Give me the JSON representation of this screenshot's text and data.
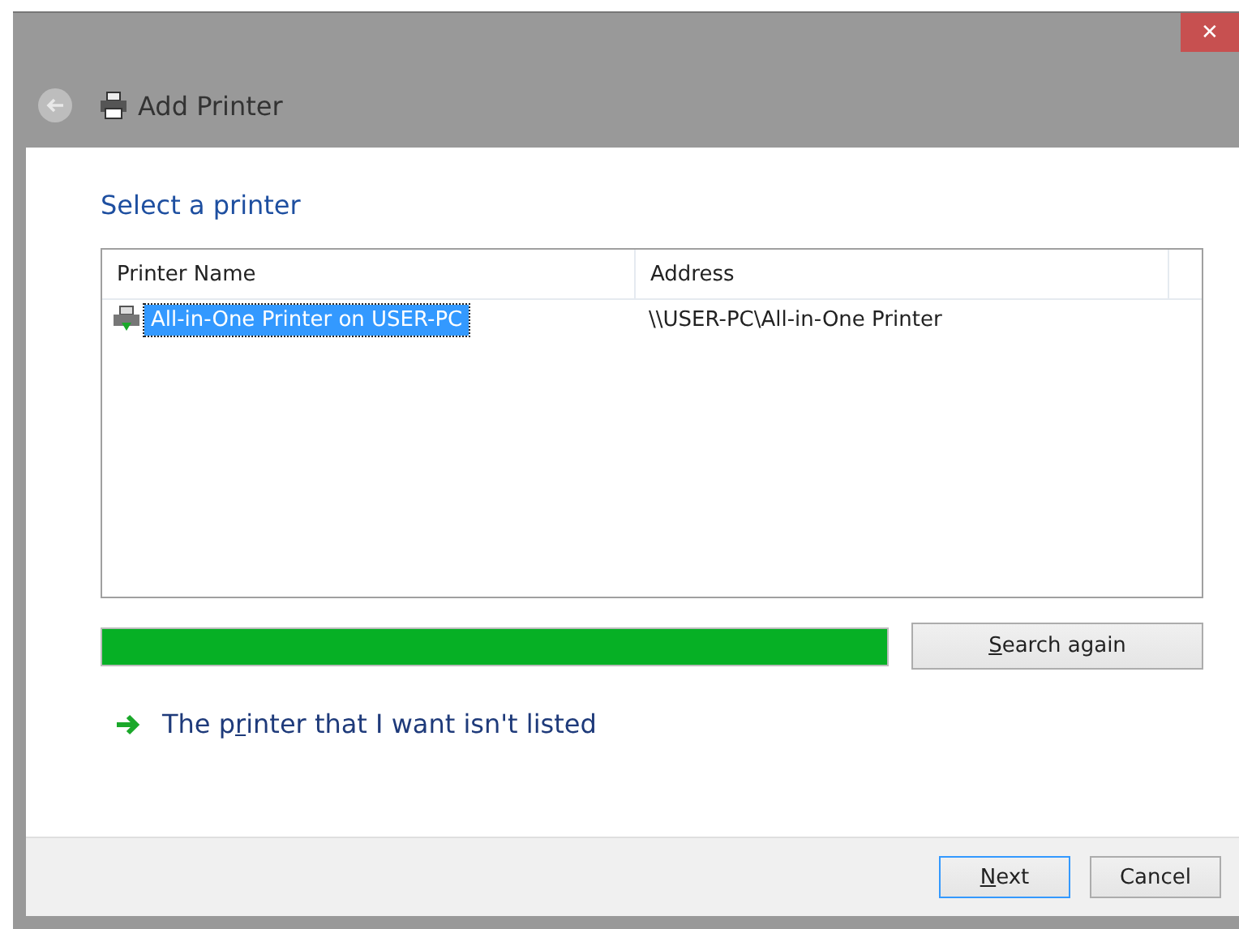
{
  "window": {
    "title": "Add Printer",
    "close": "✕"
  },
  "heading": "Select a printer",
  "table": {
    "columns": [
      "Printer Name",
      "Address"
    ],
    "rows": [
      {
        "name": "All-in-One Printer on USER-PC",
        "address": "\\\\USER-PC\\All-in-One Printer",
        "selected": true
      }
    ]
  },
  "progress": {
    "level": 1.0
  },
  "search_button": {
    "key": "S",
    "after": "earch again"
  },
  "not_listed_link": {
    "before": "The p",
    "key": "r",
    "after": "inter that I want isn't listed"
  },
  "buttons": [
    {
      "key": "N",
      "after": "ext",
      "default": true
    },
    {
      "before": "Cancel",
      "default": false
    }
  ]
}
